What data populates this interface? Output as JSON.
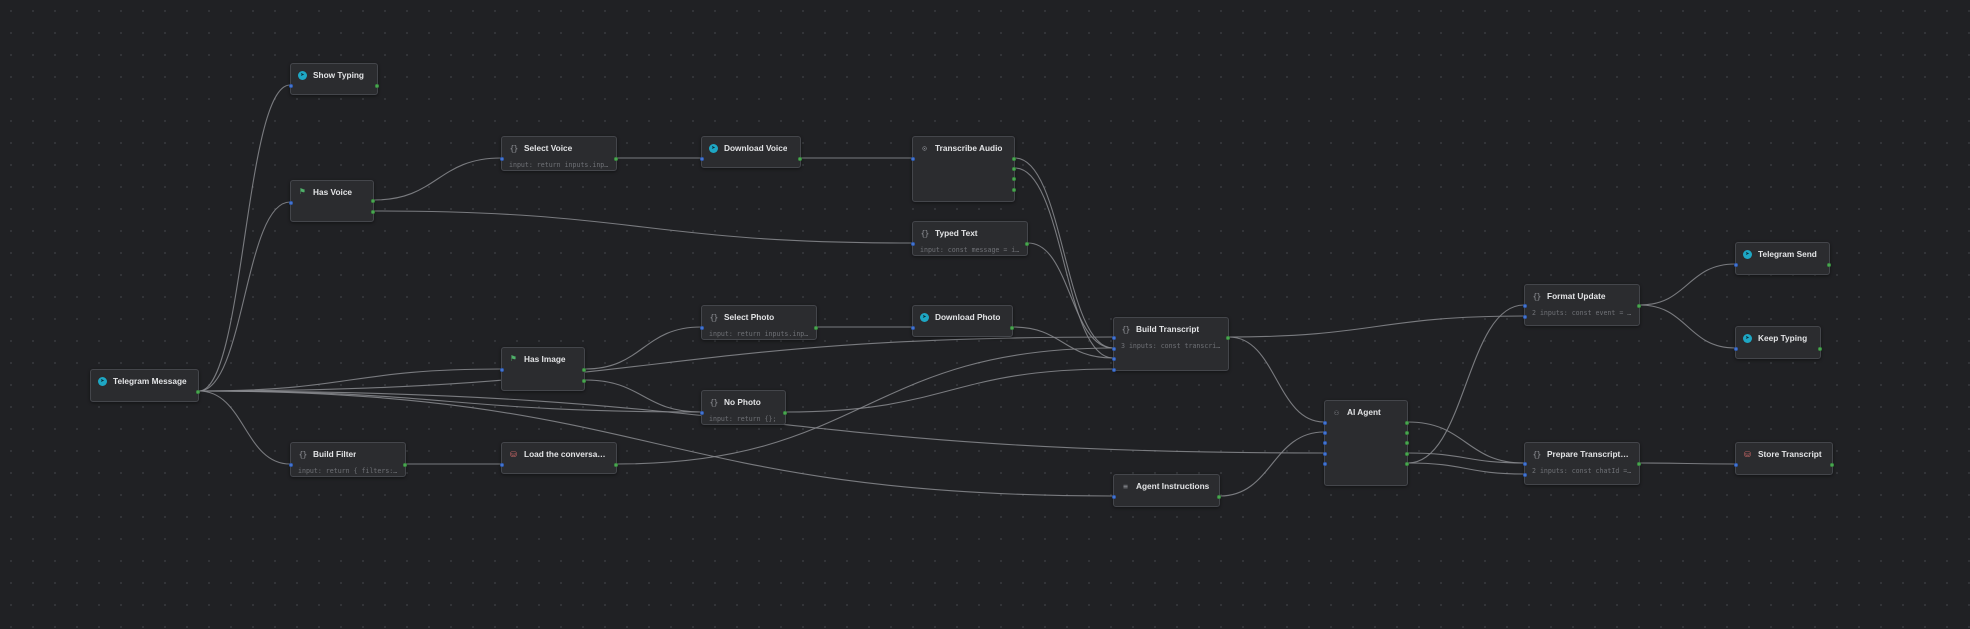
{
  "workflow": {
    "nodes": [
      {
        "id": "telegram-message",
        "name": "telegram-message-node",
        "label": "Telegram Message",
        "icon": "telegram-icon",
        "preview": ""
      },
      {
        "id": "show-typing",
        "name": "show-typing-node",
        "label": "Show Typing",
        "icon": "telegram-icon",
        "preview": ""
      },
      {
        "id": "has-voice",
        "name": "has-voice-node",
        "label": "Has Voice",
        "icon": "flag-icon",
        "preview": ""
      },
      {
        "id": "select-voice",
        "name": "select-voice-node",
        "label": "Select Voice",
        "icon": "code-icon",
        "preview": "input: return inputs.inpu…"
      },
      {
        "id": "download-voice",
        "name": "download-voice-node",
        "label": "Download Voice",
        "icon": "telegram-icon",
        "preview": ""
      },
      {
        "id": "transcribe-audio",
        "name": "transcribe-audio-node",
        "label": "Transcribe Audio",
        "icon": "microphone-icon",
        "preview": ""
      },
      {
        "id": "typed-text",
        "name": "typed-text-node",
        "label": "Typed Text",
        "icon": "code-icon",
        "preview": "input: const message = in…"
      },
      {
        "id": "select-photo",
        "name": "select-photo-node",
        "label": "Select Photo",
        "icon": "code-icon",
        "preview": "input: return inputs.inpu…"
      },
      {
        "id": "download-photo",
        "name": "download-photo-node",
        "label": "Download Photo",
        "icon": "telegram-icon",
        "preview": ""
      },
      {
        "id": "has-image",
        "name": "has-image-node",
        "label": "Has Image",
        "icon": "flag-icon",
        "preview": ""
      },
      {
        "id": "no-photo",
        "name": "no-photo-node",
        "label": "No Photo",
        "icon": "code-icon",
        "preview": "input: return {};"
      },
      {
        "id": "build-filter",
        "name": "build-filter-node",
        "label": "Build Filter",
        "icon": "code-icon",
        "preview": "input: return { filters: …"
      },
      {
        "id": "load-conversation",
        "name": "load-conversation-node",
        "label": "Load the conversa…",
        "icon": "database-icon",
        "preview": ""
      },
      {
        "id": "build-transcript",
        "name": "build-transcript-node",
        "label": "Build Transcript",
        "icon": "code-icon",
        "preview": "3 inputs: const transcrip…"
      },
      {
        "id": "agent-instructions",
        "name": "agent-instructions-node",
        "label": "Agent Instructions",
        "icon": "instructions-icon",
        "preview": ""
      },
      {
        "id": "ai-agent",
        "name": "ai-agent-node",
        "label": "AI Agent",
        "icon": "bot-icon",
        "preview": ""
      },
      {
        "id": "format-update",
        "name": "format-update-node",
        "label": "Format Update",
        "icon": "code-icon",
        "preview": "2 inputs: const event = i…"
      },
      {
        "id": "prepare-transcript",
        "name": "prepare-transcript-node",
        "label": "Prepare Transcript…",
        "icon": "code-icon",
        "preview": "2 inputs: const chatId = …"
      },
      {
        "id": "telegram-send",
        "name": "telegram-send-node",
        "label": "Telegram Send",
        "icon": "telegram-icon",
        "preview": ""
      },
      {
        "id": "keep-typing",
        "name": "keep-typing-node",
        "label": "Keep Typing",
        "icon": "telegram-icon",
        "preview": ""
      },
      {
        "id": "store-transcript",
        "name": "store-transcript-node",
        "label": "Store Transcript",
        "icon": "database-icon",
        "preview": ""
      }
    ],
    "colors": {
      "canvas": "#202124",
      "node": "#2b2c2f",
      "edge": "#8a8b8f",
      "input_port": "#4d7dd8",
      "output_port": "#4fae55",
      "telegram_accent": "#1ea7c4",
      "database_accent": "#d96c6c",
      "condition_accent": "#4fb069"
    }
  }
}
